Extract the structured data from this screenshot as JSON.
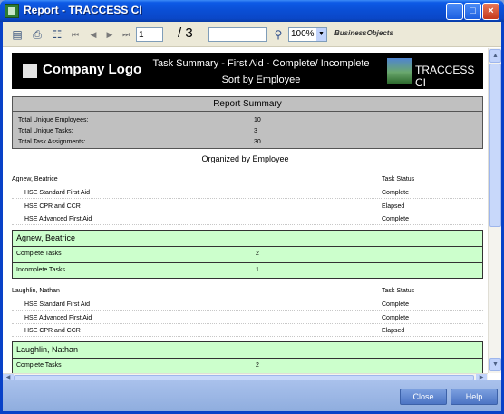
{
  "window": {
    "title": "Report - TRACCESS CI",
    "min": "_",
    "max": "□",
    "close": "×"
  },
  "toolbar": {
    "icons": [
      "export-icon",
      "print-icon",
      "group-tree-icon",
      "first-page-icon",
      "prev-page-icon",
      "next-page-icon",
      "last-page-icon",
      "search-icon"
    ],
    "icon_glyphs": {
      "export": "▤",
      "print": "⎙",
      "tree": "☷",
      "first": "⏮",
      "prev": "◀",
      "next": "▶",
      "last": "⏭",
      "search": "⚲"
    },
    "page_value": "1",
    "page_total": "/ 3",
    "search_value": "",
    "zoom": "100%",
    "zoom_arrow": "▼",
    "brand": "BusinessObjects"
  },
  "report": {
    "company_logo": "Company Logo",
    "title_line1": "Task Summary - First Aid - Complete/ Incomplete",
    "title_line2": "Sort by Employee",
    "traccess": "TRACCESS CI",
    "summary": {
      "title": "Report Summary",
      "rows": [
        {
          "label": "Total Unique Employees:",
          "value": "10"
        },
        {
          "label": "Total Unique Tasks:",
          "value": "3"
        },
        {
          "label": "Total Task Assignments:",
          "value": "30"
        }
      ]
    },
    "organized": "Organized by Employee",
    "employees": [
      {
        "name": "Agnew, Beatrice",
        "status_header": "Task Status",
        "tasks": [
          {
            "name": "HSE  Standard First Aid",
            "status": "Complete"
          },
          {
            "name": "HSE  CPR and CCR",
            "status": "Elapsed"
          },
          {
            "name": "HSE  Advanced First Aid",
            "status": "Complete"
          }
        ],
        "group_title": "Agnew, Beatrice",
        "group_rows": [
          {
            "label": "Complete Tasks",
            "value": "2"
          },
          {
            "label": "Incomplete Tasks",
            "value": "1"
          }
        ]
      },
      {
        "name": "Laughlin, Nathan",
        "status_header": "Task Status",
        "tasks": [
          {
            "name": "HSE  Standard First Aid",
            "status": "Complete"
          },
          {
            "name": "HSE  Advanced First Aid",
            "status": "Complete"
          },
          {
            "name": "HSE  CPR and CCR",
            "status": "Elapsed"
          }
        ],
        "group_title": "Laughlin, Nathan",
        "group_rows": [
          {
            "label": "Complete Tasks",
            "value": "2"
          }
        ]
      }
    ]
  },
  "scroll": {
    "up": "▲",
    "down": "▼",
    "left": "◀",
    "right": "▶"
  },
  "footer": {
    "close_label": "Close",
    "help_label": "Help"
  }
}
